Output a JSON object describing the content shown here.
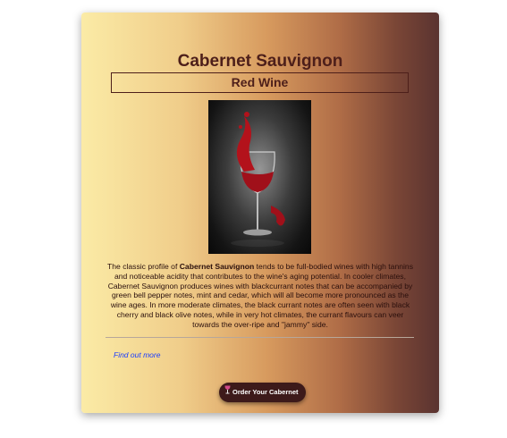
{
  "card": {
    "title": "Cabernet Sauvignon",
    "type_label": "Red Wine",
    "image_icon": "wine-glass-splash-image",
    "description": {
      "lead": "The classic profile of ",
      "name": "Cabernet Sauvignon",
      "body": " tends to be full-bodied wines with high tannins and noticeable acidity that contributes to the wine's aging potential. In cooler climates, Cabernet Sauvignon produces wines with blackcurrant notes that can be accompanied by green bell pepper notes, mint and cedar, which will all become more pronounced as the wine ages. In more moderate climates, the black currant notes are often seen with black cherry and black olive notes, while in very hot climates, the currant flavours can veer towards the over-ripe and \"jammy\" side."
    },
    "find_out_more": "Find out more",
    "order_button": {
      "icon": "wine-glass-icon",
      "label": "Order Your Cabernet"
    }
  },
  "colors": {
    "title": "#4d1f1a",
    "link": "#1a3cff",
    "button_bg": "#3d1a1a",
    "wine_red": "#b3121b"
  }
}
